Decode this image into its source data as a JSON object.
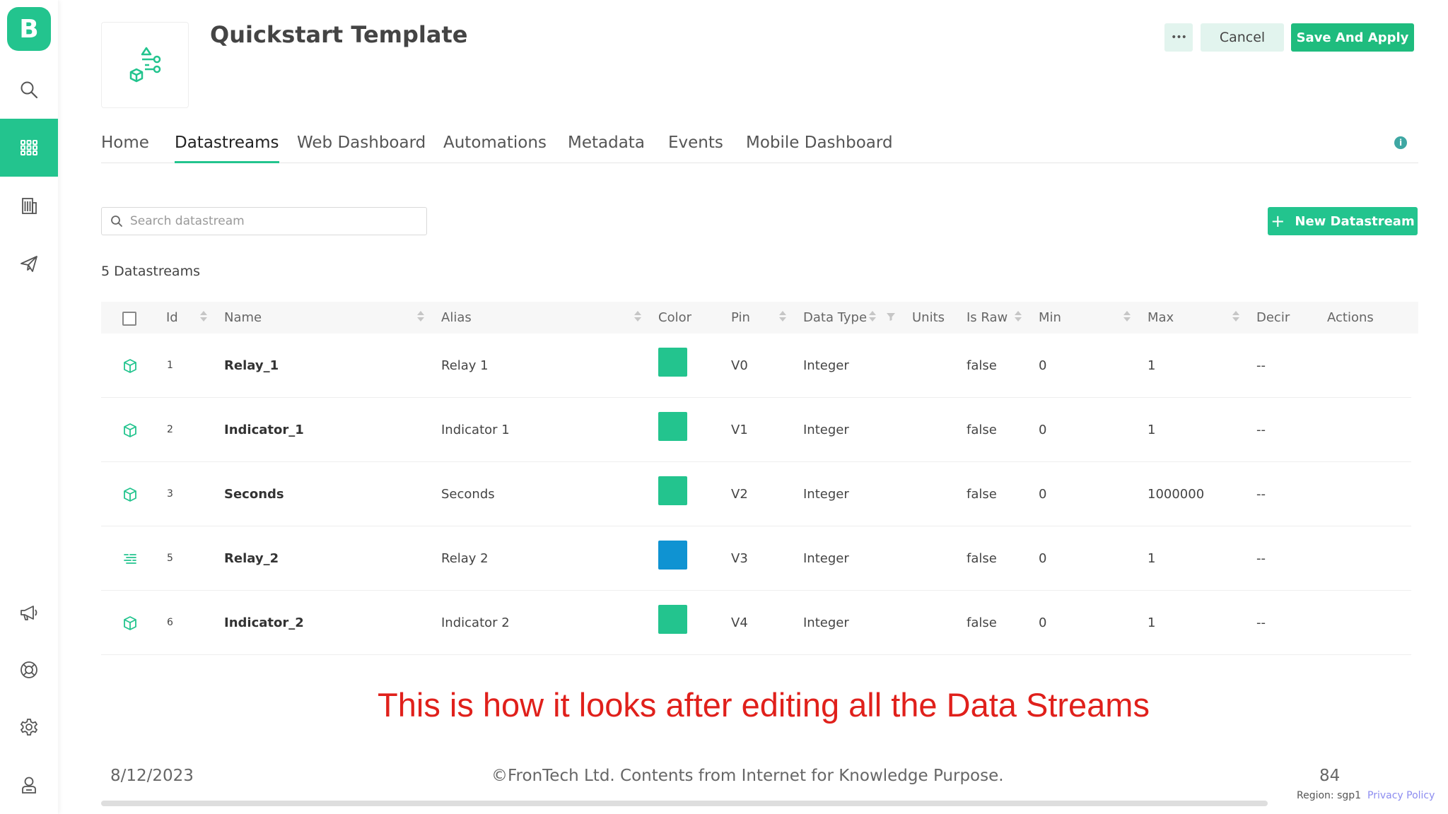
{
  "app": {
    "logo_letter": "B"
  },
  "sidebar": {
    "items": [
      {
        "icon": "search-icon"
      },
      {
        "icon": "grid-icon",
        "active": true
      },
      {
        "icon": "building-icon"
      },
      {
        "icon": "paper-plane-icon"
      },
      {
        "icon": "megaphone-icon"
      },
      {
        "icon": "lifebuoy-icon"
      },
      {
        "icon": "gear-icon"
      },
      {
        "icon": "user-badge-icon"
      }
    ]
  },
  "header": {
    "title": "Quickstart Template",
    "more_label": "•••",
    "cancel_label": "Cancel",
    "save_label": "Save And Apply"
  },
  "tabs": [
    {
      "label": "Home"
    },
    {
      "label": "Datastreams",
      "active": true
    },
    {
      "label": "Web Dashboard"
    },
    {
      "label": "Automations"
    },
    {
      "label": "Metadata"
    },
    {
      "label": "Events"
    },
    {
      "label": "Mobile Dashboard"
    }
  ],
  "info_label": "i",
  "search": {
    "placeholder": "Search datastream"
  },
  "new_datastream": {
    "plus": "+",
    "label": "New Datastream"
  },
  "count_label": "5 Datastreams",
  "table": {
    "columns": [
      "Id",
      "Name",
      "Alias",
      "Color",
      "Pin",
      "Data Type",
      "Units",
      "Is Raw",
      "Min",
      "Max",
      "Decir",
      "Actions"
    ],
    "rows": [
      {
        "type_icon": "cube-icon",
        "id": "1",
        "name": "Relay_1",
        "alias": "Relay 1",
        "color": "#23c48e",
        "pin": "V0",
        "data_type": "Integer",
        "units": "",
        "is_raw": "false",
        "min": "0",
        "max": "1",
        "decimals": "--"
      },
      {
        "type_icon": "cube-icon",
        "id": "2",
        "name": "Indicator_1",
        "alias": "Indicator 1",
        "color": "#23c48e",
        "pin": "V1",
        "data_type": "Integer",
        "units": "",
        "is_raw": "false",
        "min": "0",
        "max": "1",
        "decimals": "--"
      },
      {
        "type_icon": "cube-icon",
        "id": "3",
        "name": "Seconds",
        "alias": "Seconds",
        "color": "#23c48e",
        "pin": "V2",
        "data_type": "Integer",
        "units": "",
        "is_raw": "false",
        "min": "0",
        "max": "1000000",
        "decimals": "--"
      },
      {
        "type_icon": "lines-icon",
        "id": "5",
        "name": "Relay_2",
        "alias": "Relay 2",
        "color": "#0f93d2",
        "pin": "V3",
        "data_type": "Integer",
        "units": "",
        "is_raw": "false",
        "min": "0",
        "max": "1",
        "decimals": "--"
      },
      {
        "type_icon": "cube-icon",
        "id": "6",
        "name": "Indicator_2",
        "alias": "Indicator 2",
        "color": "#23c48e",
        "pin": "V4",
        "data_type": "Integer",
        "units": "",
        "is_raw": "false",
        "min": "0",
        "max": "1",
        "decimals": "--"
      }
    ]
  },
  "caption": "This is how it looks after editing all the Data Streams",
  "footer": {
    "date": "8/12/2023",
    "copyright": "©FronTech Ltd. Contents from Internet for Knowledge Purpose.",
    "page": "84",
    "region": "Region: sgp1",
    "privacy": "Privacy Policy"
  },
  "colors": {
    "accent": "#23c48e",
    "caption": "#e0201b"
  }
}
